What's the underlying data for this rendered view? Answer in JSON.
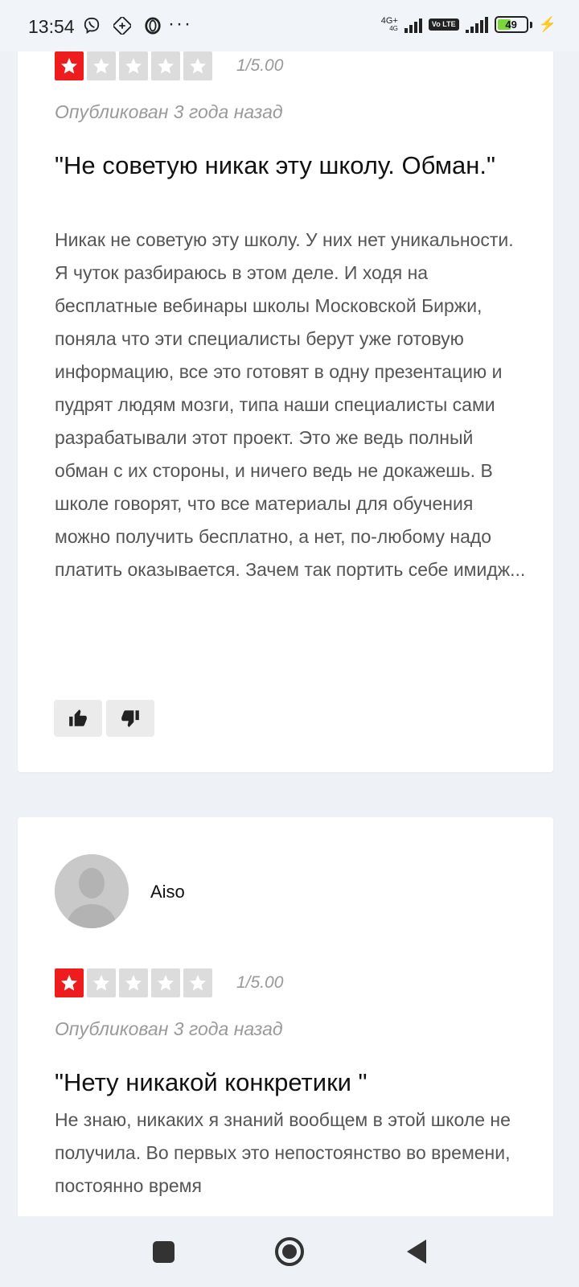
{
  "status_bar": {
    "time": "13:54",
    "icons": [
      "viber-icon",
      "sync-icon",
      "opera-icon"
    ],
    "more": "···",
    "network": "4G+",
    "network_sub": "4G",
    "volte": "Vo LTE",
    "battery": "49",
    "battery_level": 0.49
  },
  "reviews": [
    {
      "stars_filled": 1,
      "stars_total": 5,
      "score": "1/5.00",
      "published": "Опубликован 3 года назад",
      "title": "\"Не советую никак эту школу. Обман.\"",
      "body": "Никак не советую эту школу. У них нет уникальности. Я чуток разбираюсь в этом деле. И ходя на бесплатные вебинары школы Московской Биржи, поняла что эти специалисты берут уже готовую информацию, все это готовят в одну презентацию и пудрят людям мозги, типа наши специалисты сами разрабатывали этот проект. Это же ведь полный обман с их стороны, и ничего ведь не докажешь. В школе говорят, что все материалы для обучения можно получить бесплатно, а нет, по-любому надо платить оказывается. Зачем так портить себе имидж..."
    },
    {
      "author": "Aiso",
      "stars_filled": 1,
      "stars_total": 5,
      "score": "1/5.00",
      "published": "Опубликован 3 года назад",
      "title": "\"Нету никакой конкретики \"",
      "body": "Не знаю, никаких я знаний вообщем в этой школе не получила. Во первых это непостоянство во времени, постоянно время"
    }
  ],
  "colors": {
    "star_active": "#ee1c1c",
    "star_inactive": "#dcdcdc",
    "page_background": "#eef2f6"
  },
  "nav": {
    "icons": [
      "recents-icon",
      "home-icon",
      "back-icon"
    ]
  }
}
